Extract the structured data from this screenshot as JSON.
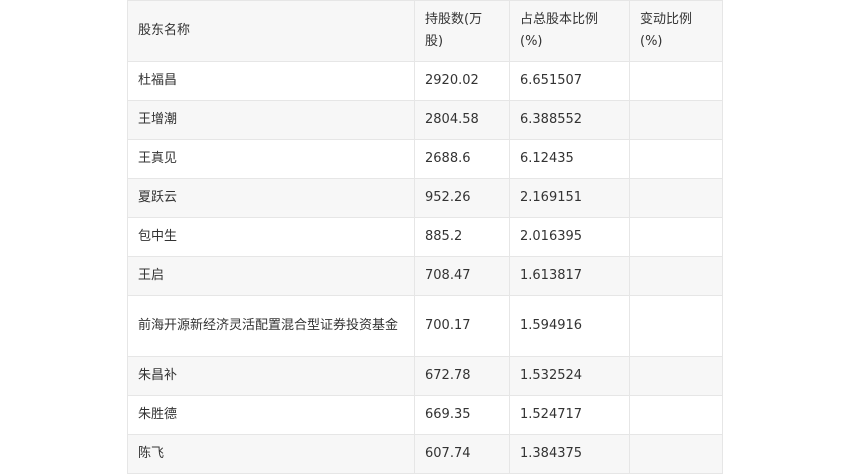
{
  "table": {
    "headers": [
      "股东名称",
      "持股数(万股)",
      "占总股本比例(%)",
      "变动比例(%)"
    ],
    "rows": [
      {
        "name": "杜福昌",
        "shares": "2920.02",
        "ratio": "6.651507",
        "change": ""
      },
      {
        "name": "王增潮",
        "shares": "2804.58",
        "ratio": "6.388552",
        "change": ""
      },
      {
        "name": "王真见",
        "shares": "2688.6",
        "ratio": "6.12435",
        "change": ""
      },
      {
        "name": "夏跃云",
        "shares": "952.26",
        "ratio": "2.169151",
        "change": ""
      },
      {
        "name": "包中生",
        "shares": "885.2",
        "ratio": "2.016395",
        "change": ""
      },
      {
        "name": "王启",
        "shares": "708.47",
        "ratio": "1.613817",
        "change": ""
      },
      {
        "name": "前海开源新经济灵活配置混合型证券投资基金",
        "shares": "700.17",
        "ratio": "1.594916",
        "change": ""
      },
      {
        "name": "朱昌补",
        "shares": "672.78",
        "ratio": "1.532524",
        "change": ""
      },
      {
        "name": "朱胜德",
        "shares": "669.35",
        "ratio": "1.524717",
        "change": ""
      },
      {
        "name": "陈飞",
        "shares": "607.74",
        "ratio": "1.384375",
        "change": ""
      }
    ]
  }
}
